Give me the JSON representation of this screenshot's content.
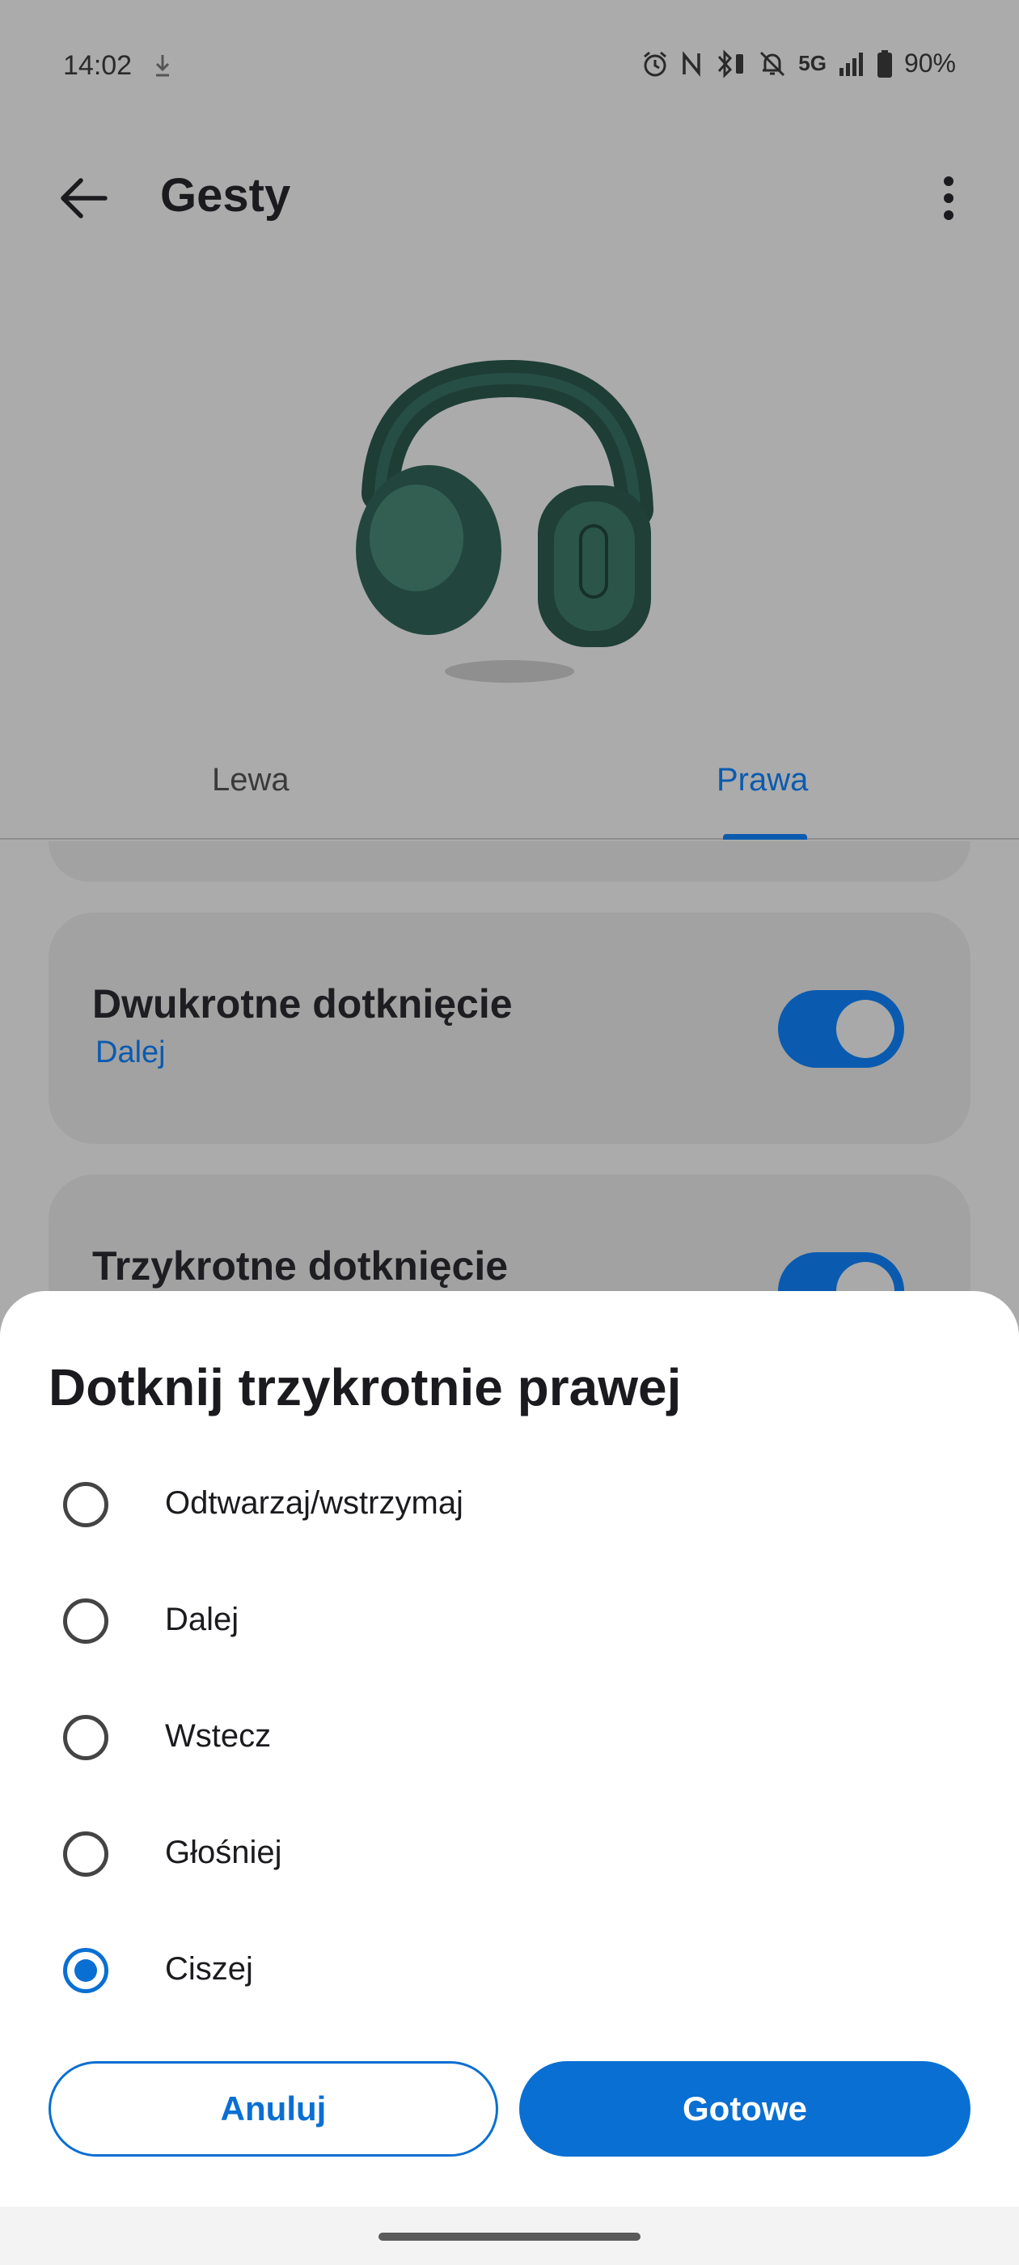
{
  "status_bar": {
    "time": "14:02",
    "network": "5G",
    "battery": "90%",
    "icons": [
      "download-icon",
      "alarm-icon",
      "nfc-icon",
      "bluetooth-battery-icon",
      "mute-icon",
      "signal-icon",
      "battery-icon"
    ]
  },
  "app_bar": {
    "title": "Gesty",
    "back_icon": "arrow-left-icon",
    "more_icon": "more-vertical-icon"
  },
  "tabs": [
    {
      "label": "Lewa",
      "selected": false
    },
    {
      "label": "Prawa",
      "selected": true
    }
  ],
  "gesture_cards": [
    {
      "title": "Dwukrotne dotknięcie",
      "subtitle": "Dalej",
      "enabled": true
    },
    {
      "title": "Trzykrotne dotknięcie",
      "enabled": true
    }
  ],
  "dialog": {
    "title": "Dotknij trzykrotnie prawej",
    "options": [
      {
        "label": "Odtwarzaj/wstrzymaj",
        "selected": false
      },
      {
        "label": "Dalej",
        "selected": false
      },
      {
        "label": "Wstecz",
        "selected": false
      },
      {
        "label": "Głośniej",
        "selected": false
      },
      {
        "label": "Ciszej",
        "selected": true
      }
    ],
    "cancel_label": "Anuluj",
    "done_label": "Gotowe"
  },
  "colors": {
    "accent": "#0a6fd3",
    "scrim_background": "#ababab",
    "sheet_background": "#ffffff"
  }
}
